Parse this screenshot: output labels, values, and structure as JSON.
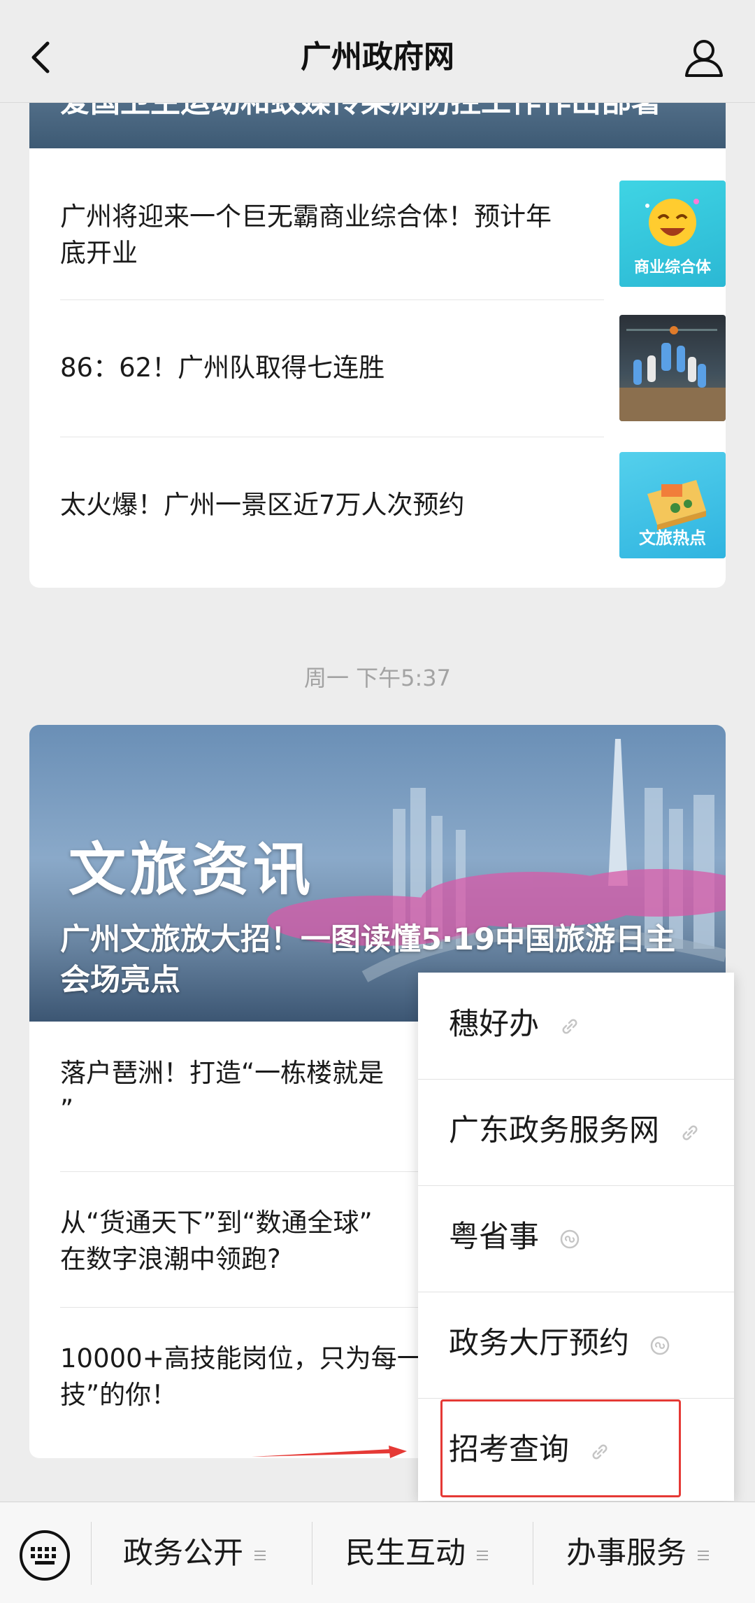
{
  "header": {
    "title": "广州政府网"
  },
  "feed1": {
    "banner_title": "爱国卫生运动和蚊媒传染病防控工作作出部署",
    "articles": [
      {
        "title": "广州将迎来一个巨无霸商业综合体！预计年底开业",
        "thumb_label": "商业综合体",
        "thumb_icon": "laughing-emoji-icon"
      },
      {
        "title": "86：62！广州队取得七连胜",
        "thumb_label": "",
        "thumb_icon": "basketball-photo"
      },
      {
        "title": "太火爆！广州一景区近7万人次预约",
        "thumb_label": "文旅热点",
        "thumb_icon": "travel-illustration"
      }
    ]
  },
  "timestamp": "周一 下午5:37",
  "feed2": {
    "hero_tag": "文旅资讯",
    "hero_title": "广州文旅放大招！一图读懂5·19中国旅游日主会场亮点",
    "articles": [
      {
        "title": "落户琶洲！打造“一栋楼就是\n”"
      },
      {
        "title": "从“货通天下”到“数通全球”\n在数字浪潮中领跑?"
      },
      {
        "title": "10000+高技能岗位，只为每一\n技”的你！"
      }
    ]
  },
  "popup_menu": {
    "items": [
      {
        "label": "穗好办",
        "icon": "link-icon"
      },
      {
        "label": "广东政务服务网",
        "icon": "link-icon"
      },
      {
        "label": "粤省事",
        "icon": "mini-program-icon"
      },
      {
        "label": "政务大厅预约",
        "icon": "mini-program-icon"
      },
      {
        "label": "招考查询",
        "icon": "link-icon"
      }
    ]
  },
  "bottom_menu": {
    "items": [
      {
        "label": "政务公开"
      },
      {
        "label": "民生互动"
      },
      {
        "label": "办事服务"
      }
    ]
  },
  "colors": {
    "highlight": "#e53935",
    "background": "#ededed"
  }
}
